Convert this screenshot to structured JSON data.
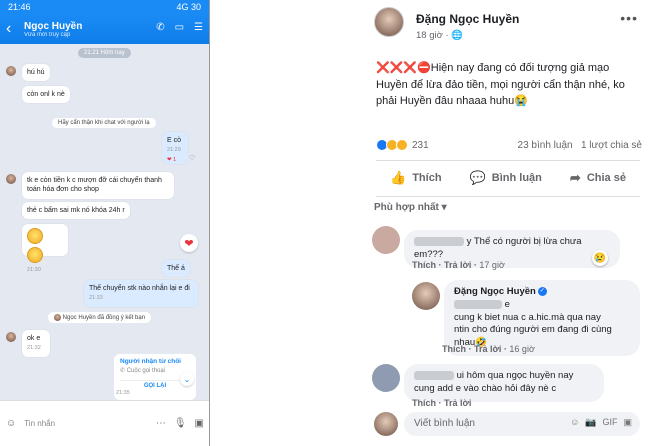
{
  "chat": {
    "status_time": "21:46",
    "status_right": "4G 30",
    "contact_name": "Ngọc Huyền",
    "contact_status": "Vừa mới truy cập",
    "header_icons": [
      "phone-icon",
      "video-icon",
      "menu-icon"
    ],
    "time_pill": "21:21 Hôm nay",
    "messages": [
      {
        "side": "them",
        "text": "hú hú"
      },
      {
        "side": "them",
        "text": "còn onl k nè"
      },
      {
        "side": "system",
        "text": "Hãy cẩn thận khi chat với người lạ"
      },
      {
        "side": "me",
        "text": "E cò",
        "time": "21:29",
        "reaction": "❤ 1"
      },
      {
        "side": "them",
        "text": "tk e còn tiền k c mượn đỡ cái chuyển thanh toán hóa đơn cho shop"
      },
      {
        "side": "them",
        "text": "thẻ c bấm sai mk nó khóa 24h r"
      },
      {
        "side": "them",
        "text": "",
        "time": "21:30"
      },
      {
        "side": "me",
        "text": "Thế á"
      },
      {
        "side": "me",
        "text": "Thế chuyển stk nào nhắn lại e đi",
        "time": "21:33"
      },
      {
        "side": "system",
        "text": "Ngọc Huyền đã đồng ý kết bạn"
      },
      {
        "side": "them",
        "text": "ok e",
        "time": "21:32"
      }
    ],
    "call_card": {
      "title": "Người nhận từ chối",
      "desc": "Cuộc gọi thoại",
      "action": "GỌI LẠI",
      "time": "21:35"
    },
    "input_placeholder": "Tin nhắn"
  },
  "fb": {
    "author": "Đặng Ngọc Huyền",
    "time": "18 giờ",
    "post_prefix": "❌❌❌⛔",
    "post_text": "Hiện nay đang có đối tượng giả mạo Huyền để lừa đảo tiền, mọi người cẩn thận nhé, ko phải Huyền đâu nhaaa huhu😭",
    "reaction_count": "231",
    "comments_count": "23 bình luận",
    "shares_count": "1 lượt chia sẻ",
    "actions": {
      "like": "Thích",
      "comment": "Bình luận",
      "share": "Chia sẻ"
    },
    "sort_label": "Phù hợp nhất",
    "comments": [
      {
        "text": "y Thế có người bị lừa chưa em???",
        "like": "Thích",
        "reply": "Trả lời",
        "time": "17 giờ"
      },
      {
        "author": "Đặng Ngọc Huyền",
        "text_1": "e",
        "text_2": "cung k biet nua c a.hic.mà qua nay",
        "text_3": "ntin cho đúng người em đang đi cùng",
        "text_4": "nhau🤣",
        "like": "Thích",
        "reply": "Trả lời",
        "time": "16 giờ"
      },
      {
        "text_1": "ui hôm qua ngọc huyền nay",
        "text_2": "cung add e vào chào hỏi đây nè c",
        "like": "Thích",
        "reply": "Trả lời"
      }
    ],
    "write_placeholder": "Viết bình luận"
  }
}
